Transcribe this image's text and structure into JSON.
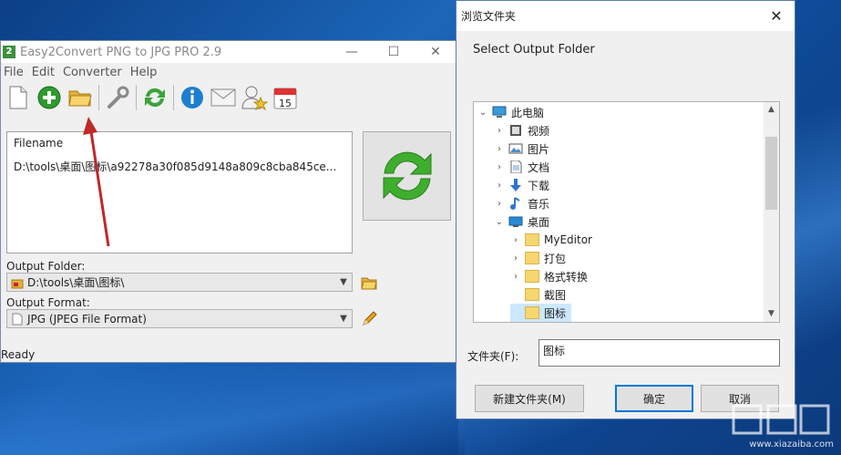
{
  "app": {
    "title": "Easy2Convert PNG to JPG PRO 2.9",
    "icon_text": "2",
    "window_controls": [
      "—",
      "☐",
      "✕"
    ],
    "menu": [
      "File",
      "Edit",
      "Converter",
      "Help"
    ],
    "toolbar_icons": [
      "new-file-icon",
      "add-file-icon",
      "open-folder-icon",
      "settings-wrench-icon",
      "refresh-convert-icon",
      "info-icon",
      "mail-icon",
      "user-star-icon",
      "calendar-icon"
    ],
    "calendar_day": "15",
    "list_header": "Filename",
    "list_rows": [
      "D:\\tools\\桌面\\图标\\a92278a30f085d9148a809c8cba845ce..."
    ],
    "output_folder_label": "Output Folder:",
    "output_folder_value": "D:\\tools\\桌面\\图标\\",
    "output_format_label": "Output Format:",
    "output_format_value": "JPG (JPEG File Format)",
    "status": "Ready"
  },
  "dialog": {
    "title": "浏览文件夹",
    "close": "✕",
    "subtitle": "Select Output Folder",
    "tree": [
      {
        "label": "此电脑",
        "icon": "computer-icon",
        "chevron": "⌄"
      },
      {
        "label": "视频",
        "icon": "video-folder-icon",
        "chevron": "›"
      },
      {
        "label": "图片",
        "icon": "pictures-folder-icon",
        "chevron": "›"
      },
      {
        "label": "文档",
        "icon": "documents-folder-icon",
        "chevron": "›"
      },
      {
        "label": "下载",
        "icon": "downloads-folder-icon",
        "chevron": "›"
      },
      {
        "label": "音乐",
        "icon": "music-folder-icon",
        "chevron": "›"
      },
      {
        "label": "桌面",
        "icon": "desktop-folder-icon",
        "chevron": "⌄"
      },
      {
        "label": "MyEditor",
        "icon": "folder-icon",
        "chevron": "›"
      },
      {
        "label": "打包",
        "icon": "folder-icon",
        "chevron": "›"
      },
      {
        "label": "格式转换",
        "icon": "folder-icon",
        "chevron": "›"
      },
      {
        "label": "截图",
        "icon": "folder-icon",
        "chevron": ""
      },
      {
        "label": "图标",
        "icon": "folder-icon",
        "chevron": ""
      }
    ],
    "folder_label": "文件夹(F):",
    "folder_value": "图标",
    "new_folder_button": "新建文件夹(M)",
    "ok_button": "确定",
    "cancel_button": "取消"
  },
  "watermark": "www.xiazaiba.com",
  "colors": {
    "accent": "#0078d7",
    "selection": "#cce8ff",
    "arrow": "#c0282a"
  }
}
